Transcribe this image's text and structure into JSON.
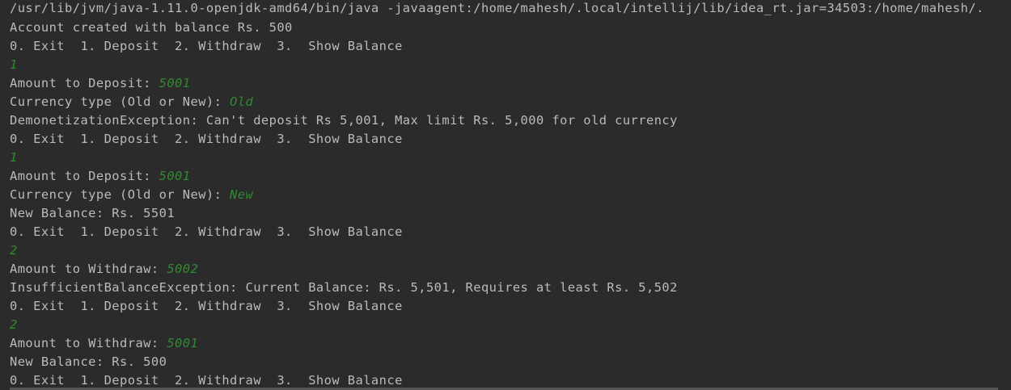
{
  "console": {
    "command": "/usr/lib/jvm/java-1.11.0-openjdk-amd64/bin/java -javaagent:/home/mahesh/.local/intellij/lib/idea_rt.jar=34503:/home/mahesh/.",
    "lines": [
      {
        "prompt": "Account created with balance Rs. 500",
        "input": ""
      },
      {
        "prompt": "0. Exit  1. Deposit  2. Withdraw  3.  Show Balance",
        "input": ""
      },
      {
        "prompt": "",
        "input": "1"
      },
      {
        "prompt": "Amount to Deposit: ",
        "input": "5001"
      },
      {
        "prompt": "Currency type (Old or New): ",
        "input": "Old"
      },
      {
        "prompt": "DemonetizationException: Can't deposit Rs 5,001, Max limit Rs. 5,000 for old currency",
        "input": ""
      },
      {
        "prompt": "0. Exit  1. Deposit  2. Withdraw  3.  Show Balance",
        "input": ""
      },
      {
        "prompt": "",
        "input": "1"
      },
      {
        "prompt": "Amount to Deposit: ",
        "input": "5001"
      },
      {
        "prompt": "Currency type (Old or New): ",
        "input": "New"
      },
      {
        "prompt": "New Balance: Rs. 5501",
        "input": ""
      },
      {
        "prompt": "0. Exit  1. Deposit  2. Withdraw  3.  Show Balance",
        "input": ""
      },
      {
        "prompt": "",
        "input": "2"
      },
      {
        "prompt": "Amount to Withdraw: ",
        "input": "5002"
      },
      {
        "prompt": "InsufficientBalanceException: Current Balance: Rs. 5,501, Requires at least Rs. 5,502",
        "input": ""
      },
      {
        "prompt": "0. Exit  1. Deposit  2. Withdraw  3.  Show Balance",
        "input": ""
      },
      {
        "prompt": "",
        "input": "2"
      },
      {
        "prompt": "Amount to Withdraw: ",
        "input": "5001"
      },
      {
        "prompt": "New Balance: Rs. 500",
        "input": ""
      },
      {
        "prompt": "0. Exit  1. Deposit  2. Withdraw  3.  Show Balance",
        "input": ""
      }
    ]
  },
  "colors": {
    "background": "#2b2b2b",
    "output_text": "#bbbbbb",
    "user_input": "#2e8b2e"
  }
}
